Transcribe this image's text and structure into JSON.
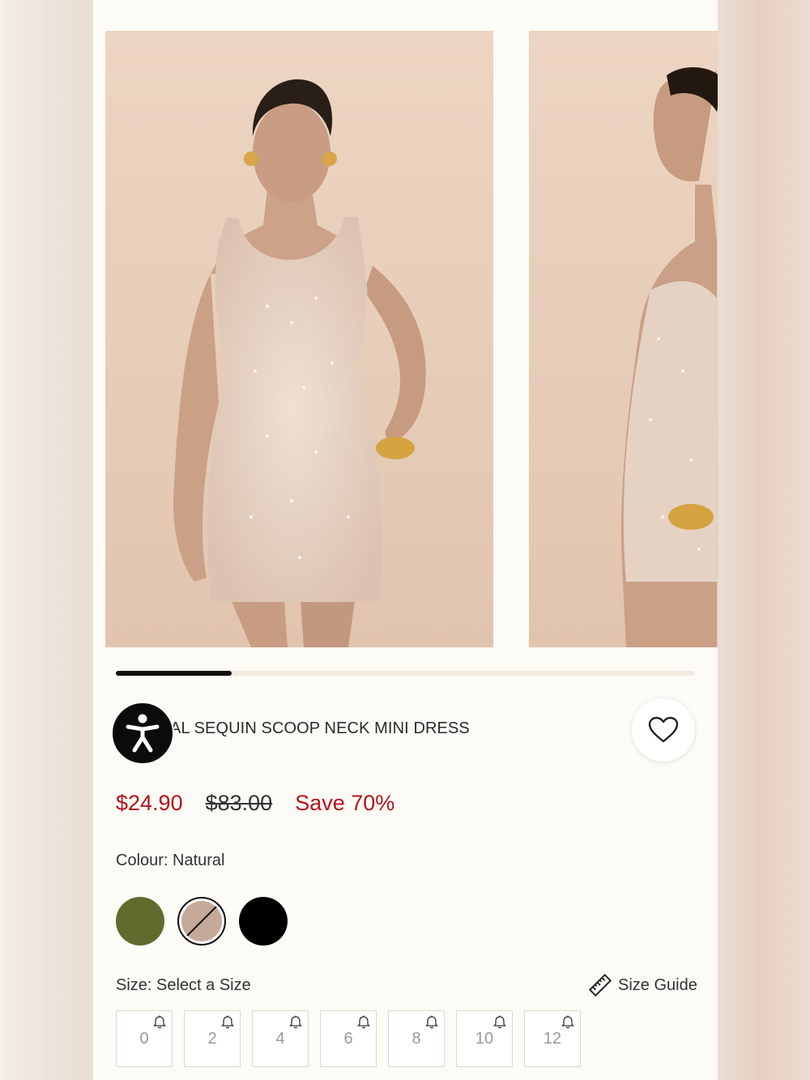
{
  "product": {
    "title_visible": "AL SEQUIN SCOOP NECK MINI DRESS",
    "gallery_progress": 0.2
  },
  "pricing": {
    "current": "$24.90",
    "original": "$83.00",
    "save": "Save 70%"
  },
  "colour": {
    "label": "Colour: Natural",
    "options": [
      {
        "name": "Olive",
        "hex": "#626b2d"
      },
      {
        "name": "Natural",
        "hex": "#c7a999",
        "selected": true,
        "unavailable": true
      },
      {
        "name": "Black",
        "hex": "#000000"
      }
    ]
  },
  "size": {
    "label": "Size: Select a Size",
    "guide_label": "Size Guide",
    "options": [
      "0",
      "2",
      "4",
      "6",
      "8",
      "10",
      "12"
    ]
  },
  "icons": {
    "accessibility": "accessibility-icon",
    "wishlist": "heart-icon",
    "size_guide": "ruler-icon",
    "notify": "bell-icon"
  },
  "colors": {
    "sale_red": "#b3141c",
    "page_bg": "#fdfbf6"
  }
}
